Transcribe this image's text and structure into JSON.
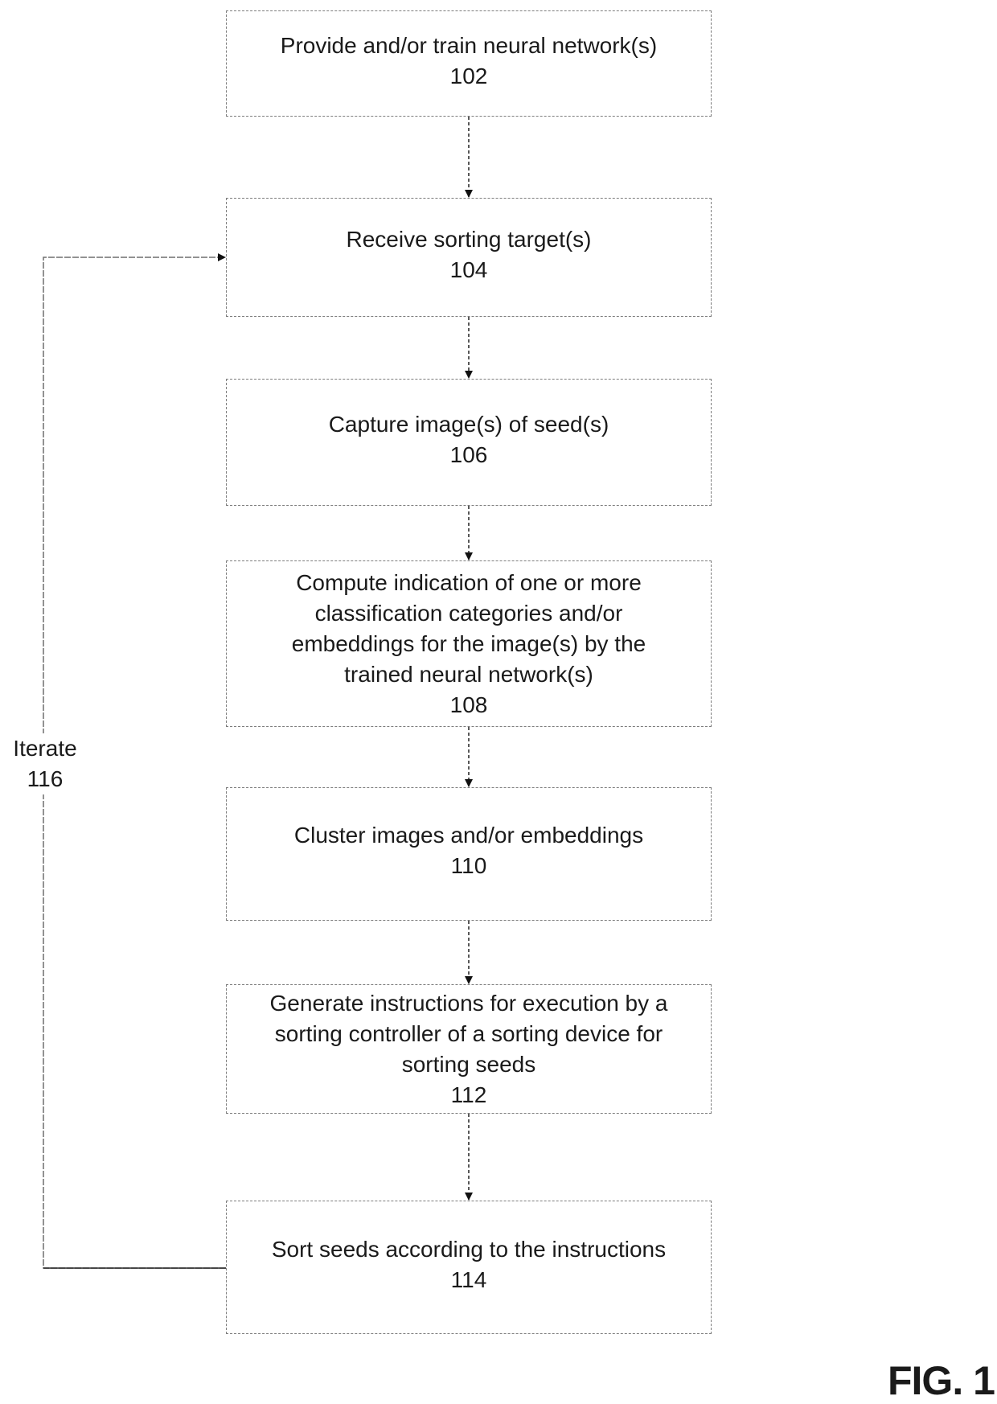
{
  "figure_label": "FIG. 1",
  "steps": [
    {
      "id": "102",
      "text": "Provide and/or train neural network(s)",
      "number": "102"
    },
    {
      "id": "104",
      "text": "Receive sorting target(s)",
      "number": "104"
    },
    {
      "id": "106",
      "text": "Capture image(s) of seed(s)",
      "number": "106"
    },
    {
      "id": "108",
      "text": "Compute indication of one or more classification categories and/or embeddings for the image(s) by the trained neural network(s)",
      "number": "108"
    },
    {
      "id": "110",
      "text": "Cluster images and/or embeddings",
      "number": "110"
    },
    {
      "id": "112",
      "text": "Generate instructions for execution by a sorting controller of a sorting device for sorting seeds",
      "number": "112"
    },
    {
      "id": "114",
      "text": "Sort seeds according to the instructions",
      "number": "114"
    }
  ],
  "loop": {
    "label": "Iterate",
    "number": "116",
    "from": "114",
    "to": "104"
  },
  "colors": {
    "box_border": "#7d7d7d",
    "connector": "#222222",
    "text": "#1a1a1a"
  }
}
